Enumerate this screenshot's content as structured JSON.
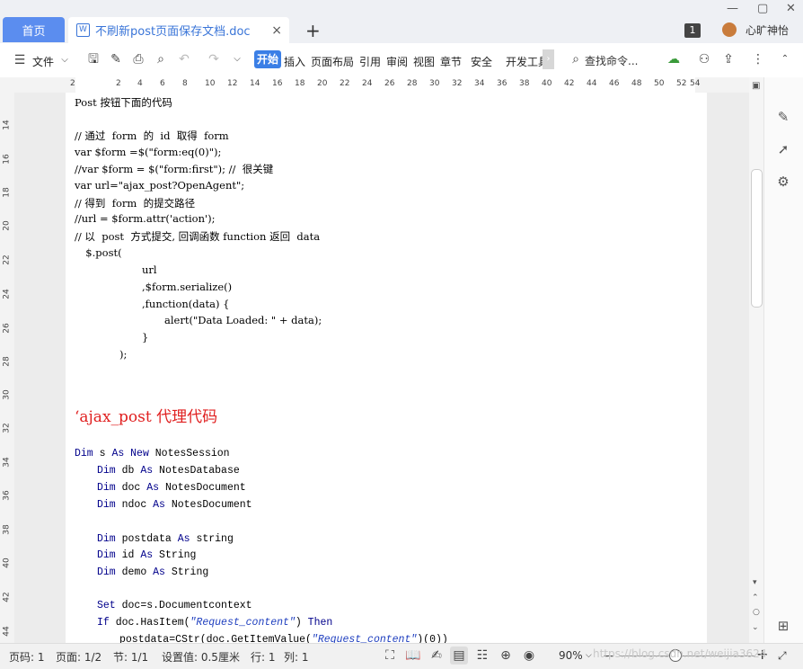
{
  "titlebar": {
    "home_tab": "首页",
    "doc_tab": "不刷新post页面保存文档.doc",
    "doc_icon": "W",
    "close": "×",
    "new_tab": "+",
    "badge": "1",
    "username": "心旷神怡"
  },
  "toolbar": {
    "file": "文件",
    "menus": [
      "开始",
      "插入",
      "页面布局",
      "引用",
      "审阅",
      "视图",
      "章节",
      "安全",
      "开发工具"
    ],
    "search": "查找命令...",
    "more": "›"
  },
  "ruler": {
    "top_numbers": [
      "2",
      "2",
      "4",
      "6",
      "8",
      "10",
      "12",
      "14",
      "16",
      "18",
      "20",
      "22",
      "24",
      "26",
      "28",
      "30",
      "32",
      "34",
      "36",
      "38",
      "40",
      "42",
      "44",
      "46",
      "48",
      "50",
      "52",
      "54"
    ],
    "left_numbers": [
      "14",
      "16",
      "18",
      "20",
      "22",
      "24",
      "26",
      "28",
      "30",
      "32",
      "34",
      "36",
      "38",
      "40",
      "42",
      "44"
    ]
  },
  "document": {
    "lines": [
      "Post 按钮下面的代码",
      "// 通过  form  的  id  取得  form",
      "var $form =$(\"form:eq(0)\");",
      "//var $form = $(\"form:first\"); //  很关键",
      "var url=\"ajax_post?OpenAgent\";",
      "// 得到  form  的提交路径",
      "//url = $form.attr('action');",
      "// 以  post  方式提交, 回调函数 function 返回  data",
      "  $.post(",
      "url",
      ",$form.serialize()",
      ",function(data) {",
      "alert(\"Data Loaded: \" + data);",
      "}",
      ");"
    ],
    "heading": "‘ajax_post 代理代码",
    "code": [
      {
        "kw": "Dim",
        "a": " s ",
        "kw2": "As New",
        "b": " NotesSession"
      },
      {
        "kw": "Dim",
        "a": " db ",
        "kw2": "As",
        "b": " NotesDatabase"
      },
      {
        "kw": "Dim",
        "a": " doc ",
        "kw2": "As",
        "b": " NotesDocument"
      },
      {
        "kw": "Dim",
        "a": " ndoc ",
        "kw2": "As",
        "b": " NotesDocument"
      },
      {
        "kw": "Dim",
        "a": " postdata ",
        "kw2": "As",
        "b": " string"
      },
      {
        "kw": "Dim",
        "a": " id ",
        "kw2": "As",
        "b": " String"
      },
      {
        "kw": "Dim",
        "a": " demo ",
        "kw2": "As",
        "b": " String"
      },
      {
        "kw": "Set",
        "a": " doc=s.Documentcontext",
        "kw2": "",
        "b": ""
      },
      {
        "kw": "If",
        "a": " doc.HasItem(",
        "str": "\"Request_content\"",
        "c": ") ",
        "kw2": "Then",
        "b": ""
      },
      {
        "kw": "",
        "a": "postdata=CStr(doc.GetItemValue(",
        "str": "\"Request_content\"",
        "c": ")(0))",
        "kw2": "",
        "b": ""
      }
    ]
  },
  "status": {
    "page_num": "页码: 1",
    "page": "页面: 1/2",
    "section": "节: 1/1",
    "setting": "设置值: 0.5厘米",
    "row": "行: 1",
    "col": "列: 1",
    "zoom": "90%",
    "watermark": "https://blog.csdn.net/weijia3624"
  },
  "colors": {
    "accent": "#3b7fe6",
    "home_tab": "#5b8def",
    "heading_red": "#e02020",
    "keyword_blue": "#00008b"
  }
}
